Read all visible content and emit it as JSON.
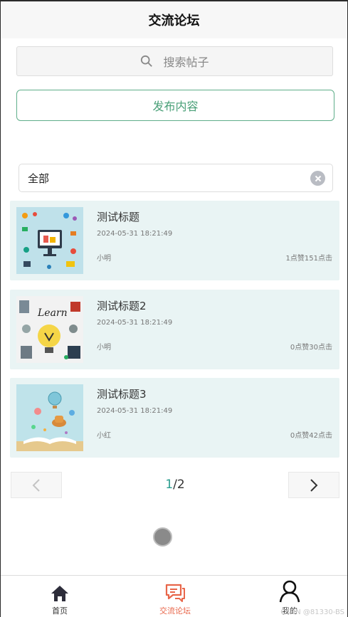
{
  "header": {
    "title": "交流论坛"
  },
  "search": {
    "placeholder": "搜索帖子",
    "icon": "search-icon"
  },
  "publish": {
    "label": "发布内容"
  },
  "filter": {
    "value": "全部",
    "clear_icon": "clear-icon"
  },
  "posts": [
    {
      "title": "测试标题",
      "date": "2024-05-31 18:21:49",
      "author": "小明",
      "stats": "1点赞151点击"
    },
    {
      "title": "测试标题2",
      "date": "2024-05-31 18:21:49",
      "author": "小明",
      "stats": "0点赞30点击"
    },
    {
      "title": "测试标题3",
      "date": "2024-05-31 18:21:49",
      "author": "小红",
      "stats": "0点赞42点击"
    }
  ],
  "pager": {
    "current": "1",
    "total": "/2"
  },
  "tabbar": {
    "items": [
      {
        "label": "首页",
        "icon": "home-icon"
      },
      {
        "label": "交流论坛",
        "icon": "chat-icon",
        "active": true
      },
      {
        "label": "我的",
        "icon": "user-icon"
      }
    ]
  },
  "watermark": "CSDN @81330-BS",
  "colors": {
    "accent": "#4aa078",
    "active_tab": "#e8664a",
    "card_bg": "#e9f4f4"
  }
}
